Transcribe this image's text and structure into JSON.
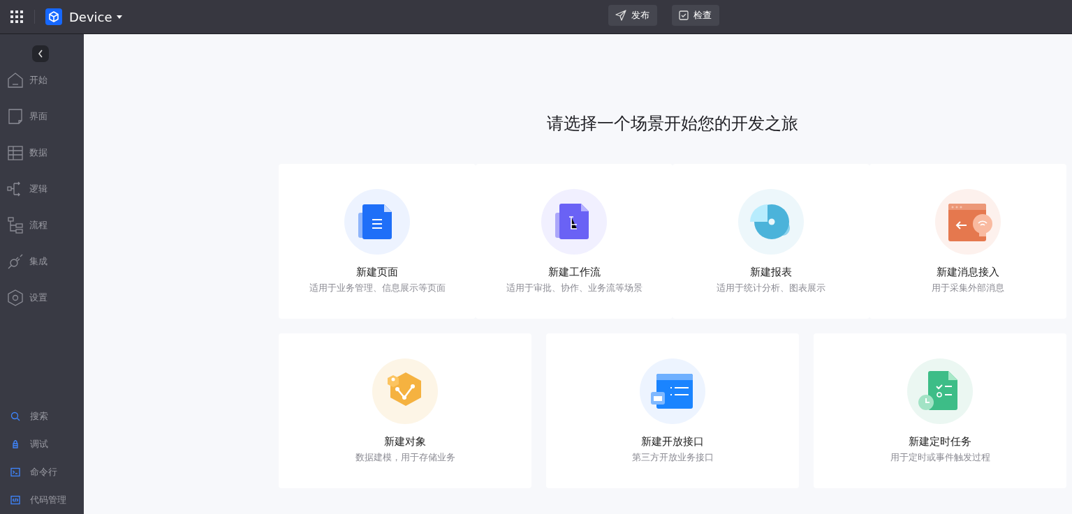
{
  "header": {
    "app_name": "Device",
    "actions": [
      {
        "label": "发布",
        "kind": "publish"
      },
      {
        "label": "检查",
        "kind": "check"
      }
    ]
  },
  "sidebar": {
    "items": [
      {
        "label": "开始",
        "kind": "home"
      },
      {
        "label": "界面",
        "kind": "page"
      },
      {
        "label": "数据",
        "kind": "table"
      },
      {
        "label": "逻辑",
        "kind": "logic"
      },
      {
        "label": "流程",
        "kind": "flow"
      },
      {
        "label": "集成",
        "kind": "plug"
      },
      {
        "label": "设置",
        "kind": "settings"
      }
    ],
    "tools": [
      {
        "label": "搜索",
        "kind": "search"
      },
      {
        "label": "调试",
        "kind": "debug"
      },
      {
        "label": "命令行",
        "kind": "terminal"
      },
      {
        "label": "代码管理",
        "kind": "code"
      }
    ]
  },
  "main": {
    "title": "请选择一个场景开始您的开发之旅",
    "cards_row_1": [
      {
        "title": "新建页面",
        "description": "适用于业务管理、信息展示等页面",
        "kind": "page"
      },
      {
        "title": "新建工作流",
        "description": "适用于审批、协作、业务流等场景",
        "kind": "workflow"
      },
      {
        "title": "新建报表",
        "description": "适用于统计分析、图表展示",
        "kind": "report"
      },
      {
        "title": "新建消息接入",
        "description": "用于采集外部消息",
        "kind": "message"
      }
    ],
    "cards_row_2": [
      {
        "title": "新建对象",
        "description": "数据建模，用于存储业务",
        "kind": "object"
      },
      {
        "title": "新建开放接口",
        "description": "第三方开放业务接口",
        "kind": "api"
      },
      {
        "title": "新建定时任务",
        "description": "用于定时或事件触发过程",
        "kind": "schedule"
      }
    ]
  }
}
